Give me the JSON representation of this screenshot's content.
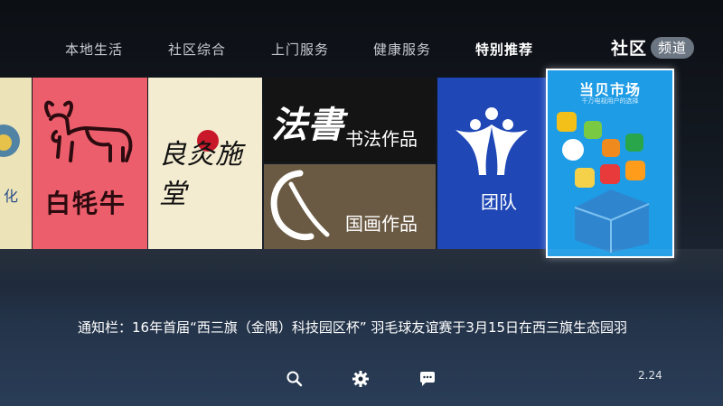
{
  "nav": {
    "tabs": [
      {
        "label": "本地生活",
        "active": false
      },
      {
        "label": "社区综合",
        "active": false
      },
      {
        "label": "上门服务",
        "active": false
      },
      {
        "label": "健康服务",
        "active": false
      },
      {
        "label": "特别推荐",
        "active": true
      }
    ],
    "channel_title": "社区",
    "channel_badge": "频道"
  },
  "tiles": {
    "culture_partial": "化",
    "yak_text": "白牦牛",
    "moxa_text": "良灸施堂",
    "calligraphy_label": "书法作品",
    "calligraphy_art": "法書",
    "painting_label": "国画作品",
    "team_label": "团队",
    "market_title": "当贝市场",
    "market_subtitle": "千万电视用户的选择"
  },
  "notice": {
    "label": "通知栏：",
    "text": "16年首届“西三旗（金隅）科技园区杯” 羽毛球友谊赛于3月15日在西三旗生态园羽"
  },
  "bottom": {
    "icons": [
      "search-icon",
      "settings-icon",
      "message-icon"
    ],
    "time": "2.24"
  }
}
